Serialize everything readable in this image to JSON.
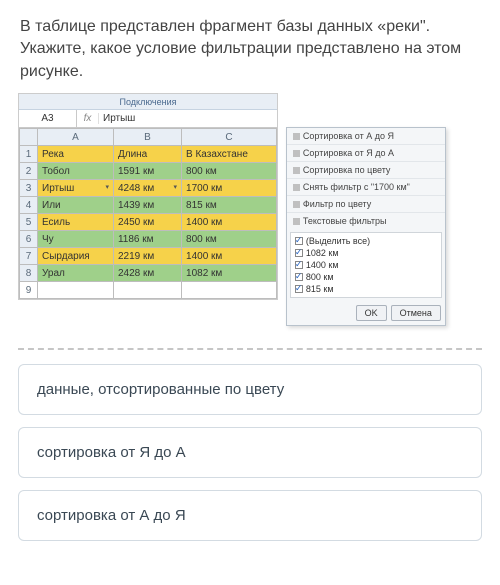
{
  "question": {
    "text": "В таблице представлен фрагмент базы данных «реки\". Укажите, какое условие фильтрации представлено на этом рисунке."
  },
  "excel": {
    "ribbon_hint": "Подключения",
    "name_box": "A3",
    "fx_label": "fx",
    "formula_value": "Иртыш",
    "col_headers": [
      "",
      "A",
      "B",
      "C"
    ],
    "rows": [
      {
        "n": "1",
        "cls": "hdr",
        "cells": [
          "Река",
          "Длина",
          "В Казахстане"
        ],
        "filter": false
      },
      {
        "n": "2",
        "cls": "g",
        "cells": [
          "Тобол",
          "1591 км",
          "800 км"
        ],
        "filter": false
      },
      {
        "n": "3",
        "cls": "y",
        "cells": [
          "Иртыш",
          "4248 км",
          "1700 км"
        ],
        "filter": true
      },
      {
        "n": "4",
        "cls": "g",
        "cells": [
          "Или",
          "1439 км",
          "815 км"
        ],
        "filter": false
      },
      {
        "n": "5",
        "cls": "y",
        "cells": [
          "Есиль",
          "2450 км",
          "1400 км"
        ],
        "filter": false
      },
      {
        "n": "6",
        "cls": "g",
        "cells": [
          "Чу",
          "1186 км",
          "800 км"
        ],
        "filter": false
      },
      {
        "n": "7",
        "cls": "y",
        "cells": [
          "Сырдария",
          "2219 км",
          "1400 км"
        ],
        "filter": false
      },
      {
        "n": "8",
        "cls": "g",
        "cells": [
          "Урал",
          "2428 км",
          "1082 км"
        ],
        "filter": false
      },
      {
        "n": "9",
        "cls": "",
        "cells": [
          "",
          "",
          ""
        ],
        "filter": false
      }
    ]
  },
  "filter_menu": {
    "items": [
      "Сортировка от А до Я",
      "Сортировка от Я до А",
      "Сортировка по цвету",
      "Снять фильтр с \"1700 км\"",
      "Фильтр по цвету",
      "Текстовые фильтры"
    ],
    "checklist": [
      "(Выделить все)",
      "1082 км",
      "1400 км",
      "800 км",
      "815 км"
    ],
    "ok": "OK",
    "cancel": "Отмена"
  },
  "options": [
    "данные, отсортированные по цвету",
    "сортировка от Я до А",
    "сортировка от А до Я"
  ]
}
